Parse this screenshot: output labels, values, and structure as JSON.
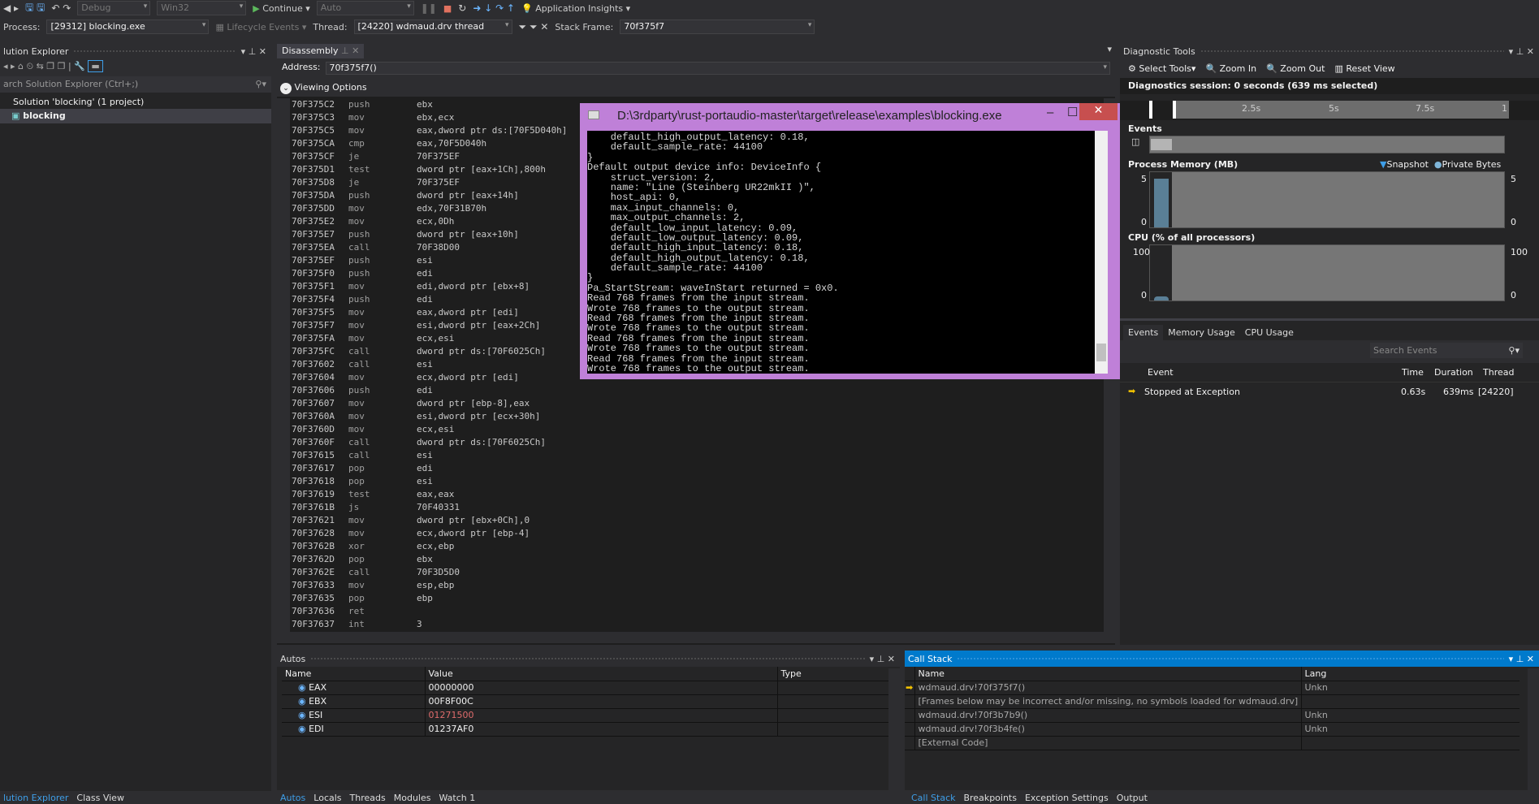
{
  "toolbar": {
    "config": "Debug",
    "platform": "Win32",
    "continue": "Continue",
    "auto": "Auto",
    "app_insights": "Application Insights",
    "process_label": "Process:",
    "process": "[29312] blocking.exe",
    "lifecycle": "Lifecycle Events",
    "thread_label": "Thread:",
    "thread": "[24220] wdmaud.drv thread",
    "stack_label": "Stack Frame:",
    "stack": "70f375f7"
  },
  "solution_explorer": {
    "title": "lution Explorer",
    "search_placeholder": "arch Solution Explorer (Ctrl+;)",
    "solution": "Solution 'blocking' (1 project)",
    "project": "blocking",
    "tabs": [
      "lution Explorer",
      "Class View"
    ]
  },
  "disassembly": {
    "tab": "Disassembly",
    "address_label": "Address:",
    "address": "70f375f7()",
    "viewing_options": "Viewing Options",
    "current_line": 17,
    "lines": [
      [
        "70F375C2",
        "push",
        "ebx"
      ],
      [
        "70F375C3",
        "mov",
        "ebx,ecx"
      ],
      [
        "70F375C5",
        "mov",
        "eax,dword ptr ds:[70F5D040h]"
      ],
      [
        "70F375CA",
        "cmp",
        "eax,70F5D040h"
      ],
      [
        "70F375CF",
        "je",
        "70F375EF"
      ],
      [
        "70F375D1",
        "test",
        "dword ptr [eax+1Ch],800h"
      ],
      [
        "70F375D8",
        "je",
        "70F375EF"
      ],
      [
        "70F375DA",
        "push",
        "dword ptr [eax+14h]"
      ],
      [
        "70F375DD",
        "mov",
        "edx,70F31B70h"
      ],
      [
        "70F375E2",
        "mov",
        "ecx,0Dh"
      ],
      [
        "70F375E7",
        "push",
        "dword ptr [eax+10h]"
      ],
      [
        "70F375EA",
        "call",
        "70F38D00"
      ],
      [
        "70F375EF",
        "push",
        "esi"
      ],
      [
        "70F375F0",
        "push",
        "edi"
      ],
      [
        "70F375F1",
        "mov",
        "edi,dword ptr [ebx+8]"
      ],
      [
        "70F375F4",
        "push",
        "edi"
      ],
      [
        "70F375F5",
        "mov",
        "eax,dword ptr [edi]"
      ],
      [
        "70F375F7",
        "mov",
        "esi,dword ptr [eax+2Ch]"
      ],
      [
        "70F375FA",
        "mov",
        "ecx,esi"
      ],
      [
        "70F375FC",
        "call",
        "dword ptr ds:[70F6025Ch]"
      ],
      [
        "70F37602",
        "call",
        "esi"
      ],
      [
        "70F37604",
        "mov",
        "ecx,dword ptr [edi]"
      ],
      [
        "70F37606",
        "push",
        "edi"
      ],
      [
        "70F37607",
        "mov",
        "dword ptr [ebp-8],eax"
      ],
      [
        "70F3760A",
        "mov",
        "esi,dword ptr [ecx+30h]"
      ],
      [
        "70F3760D",
        "mov",
        "ecx,esi"
      ],
      [
        "70F3760F",
        "call",
        "dword ptr ds:[70F6025Ch]"
      ],
      [
        "70F37615",
        "call",
        "esi"
      ],
      [
        "70F37617",
        "pop",
        "edi"
      ],
      [
        "70F37618",
        "pop",
        "esi"
      ],
      [
        "70F37619",
        "test",
        "eax,eax"
      ],
      [
        "70F3761B",
        "js",
        "70F40331"
      ],
      [
        "70F37621",
        "mov",
        "dword ptr [ebx+0Ch],0"
      ],
      [
        "70F37628",
        "mov",
        "ecx,dword ptr [ebp-4]"
      ],
      [
        "70F3762B",
        "xor",
        "ecx,ebp"
      ],
      [
        "70F3762D",
        "pop",
        "ebx"
      ],
      [
        "70F3762E",
        "call",
        "70F3D5D0"
      ],
      [
        "70F37633",
        "mov",
        "esp,ebp"
      ],
      [
        "70F37635",
        "pop",
        "ebp"
      ],
      [
        "70F37636",
        "ret",
        ""
      ],
      [
        "70F37637",
        "int",
        "3"
      ]
    ]
  },
  "console": {
    "title": "D:\\3rdparty\\rust-portaudio-master\\target\\release\\examples\\blocking.exe",
    "frame_color": "#bf80d8",
    "lines": [
      "    default_high_output_latency: 0.18,",
      "    default_sample_rate: 44100",
      "}",
      "Default output device info: DeviceInfo {",
      "    struct_version: 2,",
      "    name: \"Line (Steinberg UR22mkII )\",",
      "    host_api: 0,",
      "    max_input_channels: 0,",
      "    max_output_channels: 2,",
      "    default_low_input_latency: 0.09,",
      "    default_low_output_latency: 0.09,",
      "    default_high_input_latency: 0.18,",
      "    default_high_output_latency: 0.18,",
      "    default_sample_rate: 44100",
      "}",
      "Pa_StartStream: waveInStart returned = 0x0.",
      "Read 768 frames from the input stream.",
      "Wrote 768 frames to the output stream.",
      "Read 768 frames from the input stream.",
      "Wrote 768 frames to the output stream.",
      "Read 768 frames from the input stream.",
      "Wrote 768 frames to the output stream.",
      "Read 768 frames from the input stream.",
      "Wrote 768 frames to the output stream."
    ]
  },
  "diagnostic": {
    "title": "Diagnostic Tools",
    "select_tools": "Select Tools",
    "zoom_in": "Zoom In",
    "zoom_out": "Zoom Out",
    "reset_view": "Reset View",
    "session": "Diagnostics session: 0 seconds (639 ms selected)",
    "ruler": [
      "2.5s",
      "5s",
      "7.5s",
      "1"
    ],
    "events_label": "Events",
    "memory_label": "Process Memory (MB)",
    "snapshot": "Snapshot",
    "private_bytes": "Private Bytes",
    "mem_max": "5",
    "mem_min": "0",
    "cpu_label": "CPU (% of all processors)",
    "cpu_max": "100",
    "cpu_min": "0",
    "tabs": [
      "Events",
      "Memory Usage",
      "CPU Usage"
    ],
    "search_placeholder": "Search Events",
    "columns": [
      "Event",
      "Time",
      "Duration",
      "Thread"
    ],
    "rows": [
      {
        "event": "Stopped at Exception",
        "time": "0.63s",
        "duration": "639ms",
        "thread": "[24220]"
      }
    ]
  },
  "autos": {
    "title": "Autos",
    "columns": [
      "Name",
      "Value",
      "Type"
    ],
    "rows": [
      {
        "name": "EAX",
        "value": "00000000"
      },
      {
        "name": "EBX",
        "value": "00F8F00C"
      },
      {
        "name": "ESI",
        "value": "01271500",
        "changed": true
      },
      {
        "name": "EDI",
        "value": "01237AF0"
      }
    ],
    "tabs": [
      "Autos",
      "Locals",
      "Threads",
      "Modules",
      "Watch 1"
    ]
  },
  "callstack": {
    "title": "Call Stack",
    "columns": [
      "Name",
      "Lang"
    ],
    "rows": [
      {
        "name": "wdmaud.drv!70f375f7()",
        "lang": "Unkn",
        "current": true
      },
      {
        "name": "[Frames below may be incorrect and/or missing, no symbols loaded for wdmaud.drv]",
        "lang": ""
      },
      {
        "name": "wdmaud.drv!70f3b7b9()",
        "lang": "Unkn"
      },
      {
        "name": "wdmaud.drv!70f3b4fe()",
        "lang": "Unkn"
      },
      {
        "name": "[External Code]",
        "lang": ""
      }
    ],
    "tabs": [
      "Call Stack",
      "Breakpoints",
      "Exception Settings",
      "Output"
    ]
  }
}
